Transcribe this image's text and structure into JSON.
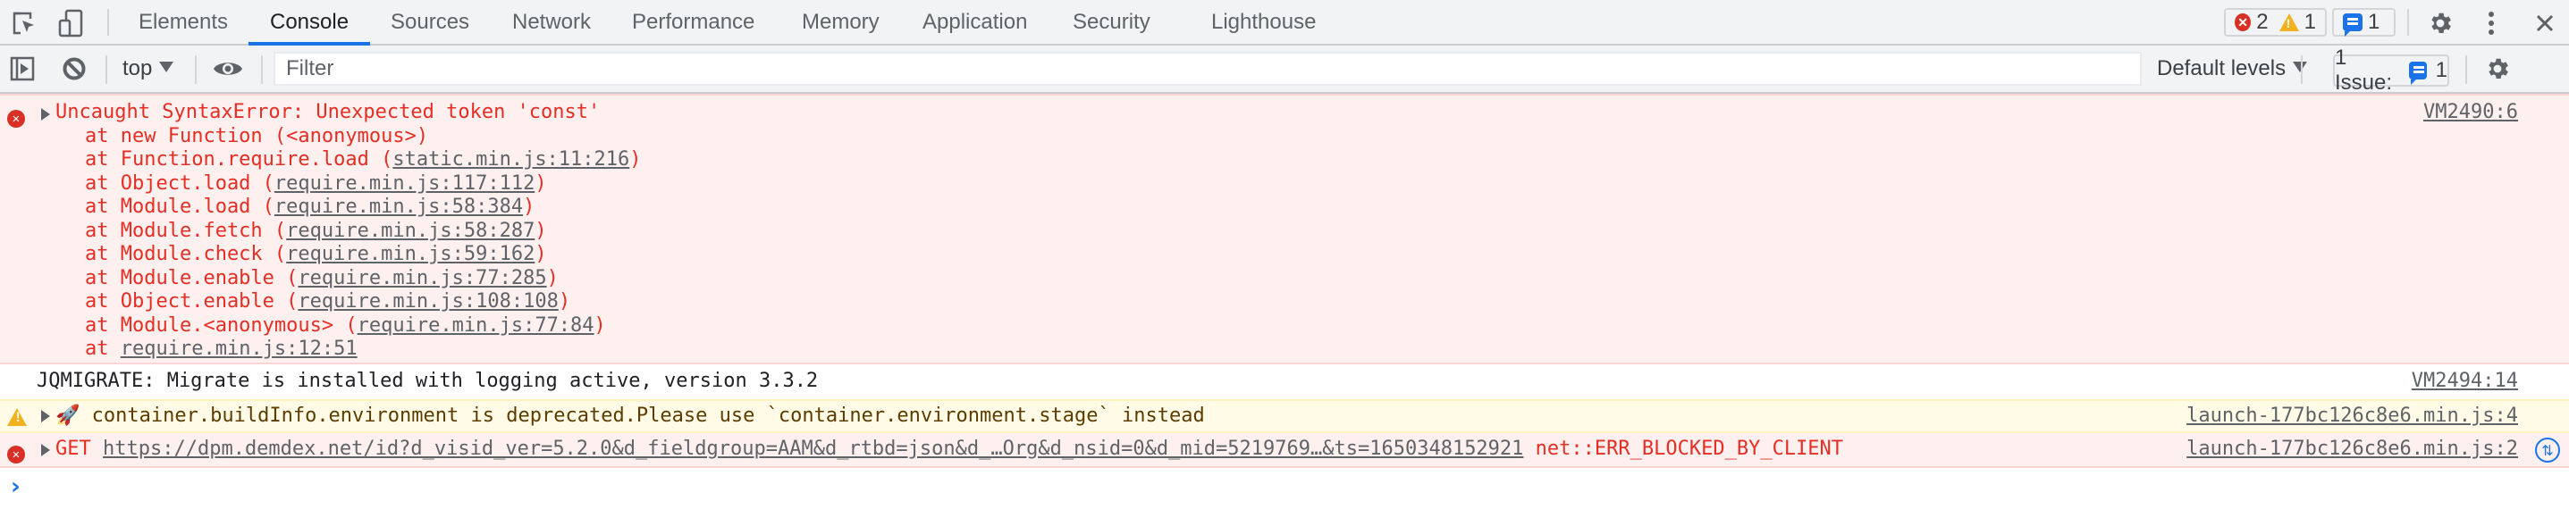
{
  "tabbar": {
    "tabs": [
      {
        "label": "Elements",
        "active": false
      },
      {
        "label": "Console",
        "active": true
      },
      {
        "label": "Sources",
        "active": false
      },
      {
        "label": "Network",
        "active": false
      },
      {
        "label": "Performance",
        "active": false
      },
      {
        "label": "Memory",
        "active": false
      },
      {
        "label": "Application",
        "active": false
      },
      {
        "label": "Security",
        "active": false
      },
      {
        "label": "Lighthouse",
        "active": false
      }
    ],
    "error_count": "2",
    "warning_count": "1",
    "message_count": "1",
    "icons": {
      "inspect": "inspect-element-icon",
      "device": "device-toolbar-icon",
      "settings": "gear-icon",
      "more": "kebab-menu-icon",
      "close": "close-icon"
    }
  },
  "toolbar": {
    "context": "top",
    "filter_placeholder": "Filter",
    "filter_value": "",
    "levels": "Default levels",
    "issues_label": "1 Issue:",
    "issues_count": "1"
  },
  "console": {
    "messages": [
      {
        "level": "error",
        "text": "Uncaught SyntaxError: Unexpected token 'const'",
        "source": "VM2490:6",
        "stack": [
          {
            "prefix": "at new Function (<anonymous>)",
            "link": "",
            "suffix": ""
          },
          {
            "prefix": "at Function.require.load (",
            "link": "static.min.js:11:216",
            "suffix": ")"
          },
          {
            "prefix": "at Object.load (",
            "link": "require.min.js:117:112",
            "suffix": ")"
          },
          {
            "prefix": "at Module.load (",
            "link": "require.min.js:58:384",
            "suffix": ")"
          },
          {
            "prefix": "at Module.fetch (",
            "link": "require.min.js:58:287",
            "suffix": ")"
          },
          {
            "prefix": "at Module.check (",
            "link": "require.min.js:59:162",
            "suffix": ")"
          },
          {
            "prefix": "at Module.enable (",
            "link": "require.min.js:77:285",
            "suffix": ")"
          },
          {
            "prefix": "at Object.enable (",
            "link": "require.min.js:108:108",
            "suffix": ")"
          },
          {
            "prefix": "at Module.<anonymous> (",
            "link": "require.min.js:77:84",
            "suffix": ")"
          },
          {
            "prefix": "at ",
            "link": "require.min.js:12:51",
            "suffix": ""
          }
        ]
      },
      {
        "level": "info",
        "text": "JQMIGRATE: Migrate is installed with logging active, version 3.3.2",
        "source": "VM2494:14"
      },
      {
        "level": "warning",
        "emoji": "🚀",
        "text": "container.buildInfo.environment is deprecated.Please use `container.environment.stage` instead",
        "source": "launch-177bc126c8e6.min.js:4"
      },
      {
        "level": "error",
        "method": "GET",
        "url": "https://dpm.demdex.net/id?d_visid_ver=5.2.0&d_fieldgroup=AAM&d_rtbd=json&d_…Org&d_nsid=0&d_mid=5219769…&ts=1650348152921",
        "status": "net::ERR_BLOCKED_BY_CLIENT",
        "source": "launch-177bc126c8e6.min.js:2"
      }
    ],
    "prompt_symbol": "›"
  }
}
